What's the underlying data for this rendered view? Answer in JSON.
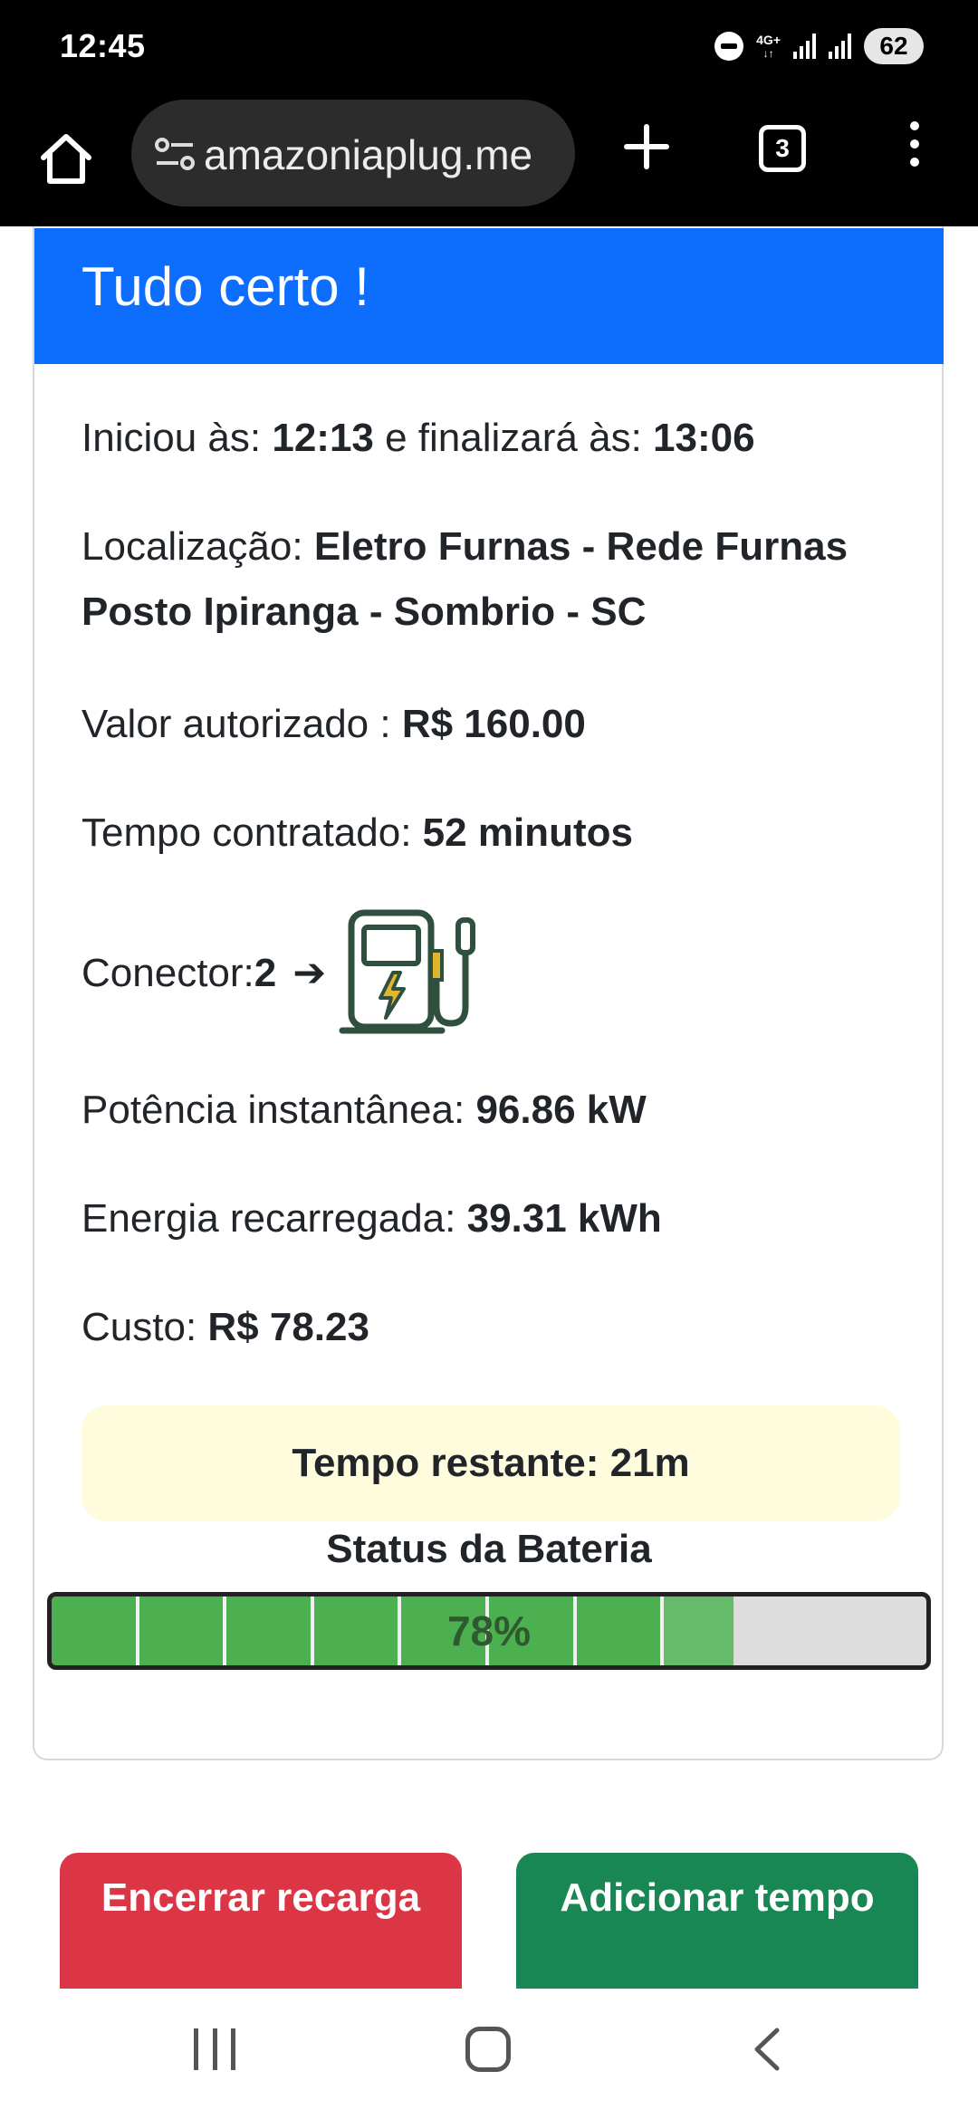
{
  "status_bar": {
    "time": "12:45",
    "network": "4G+",
    "battery": "62"
  },
  "browser": {
    "url": "amazoniaplug.me",
    "tab_count": "3"
  },
  "card": {
    "title": "Tudo certo !",
    "start_label": "Iniciou às: ",
    "start_time": "12:13",
    "end_label": " e finalizará às: ",
    "end_time": "13:06",
    "location_label": "Localização: ",
    "location_value": "Eletro Furnas - Rede Furnas Posto Ipiranga - Sombrio - SC",
    "valor_label": "Valor autorizado : ",
    "valor_value": "R$ 160.00",
    "tempo_label": "Tempo contratado: ",
    "tempo_value": "52 minutos",
    "conector_label": "Conector: ",
    "conector_value": "2",
    "conector_arrow": "➔",
    "potencia_label": "Potência instantânea: ",
    "potencia_value": "96.86 kW",
    "energia_label": "Energia recarregada: ",
    "energia_value": "39.31 kWh",
    "custo_label": "Custo: ",
    "custo_value": "R$ 78.23",
    "remaining_text": "Tempo restante: 21m",
    "battery_title": "Status da Bateria",
    "battery_percent_text": "78%",
    "battery_percent": 78
  },
  "buttons": {
    "end_label": "Encerrar recarga",
    "add_label": "Adicionar tempo"
  },
  "colors": {
    "header_blue": "#0d6efd",
    "end_button": "#dc3545",
    "add_button": "#198754",
    "battery_fill": "#4caf50",
    "remaining_bg": "#fffbdd"
  }
}
